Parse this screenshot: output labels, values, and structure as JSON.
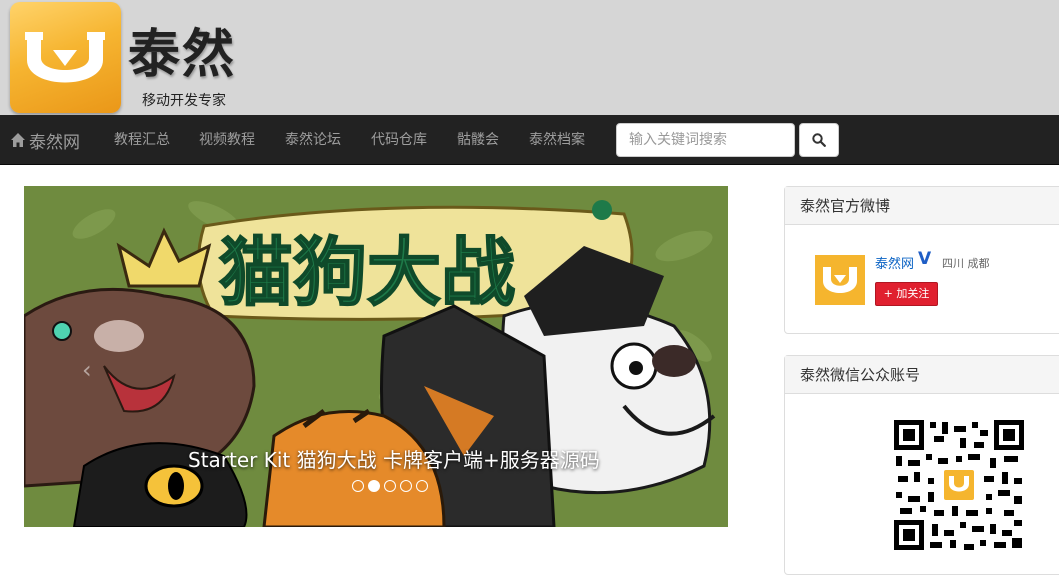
{
  "header": {
    "brand_name": "泰然",
    "tagline": "移动开发专家",
    "logo_color": "#f6b531"
  },
  "navbar": {
    "home_label": "泰然网",
    "items": [
      {
        "label": "教程汇总"
      },
      {
        "label": "视频教程"
      },
      {
        "label": "泰然论坛"
      },
      {
        "label": "代码仓库"
      },
      {
        "label": "骷髅会"
      },
      {
        "label": "泰然档案"
      }
    ],
    "search": {
      "placeholder": "输入关键词搜索",
      "value": "",
      "icon": "search-icon"
    },
    "background": "#222222"
  },
  "carousel": {
    "title_art": "猫狗大战",
    "caption": "Starter Kit 猫狗大战 卡牌客户端+服务器源码",
    "active_index": 1,
    "slide_count": 5
  },
  "weibo_panel": {
    "title": "泰然官方微博",
    "account_name": "泰然网",
    "verified_mark": "V",
    "location": "四川 成都",
    "follow_label": "加关注",
    "follow_color": "#e0202f"
  },
  "wechat_panel": {
    "title": "泰然微信公众账号"
  }
}
